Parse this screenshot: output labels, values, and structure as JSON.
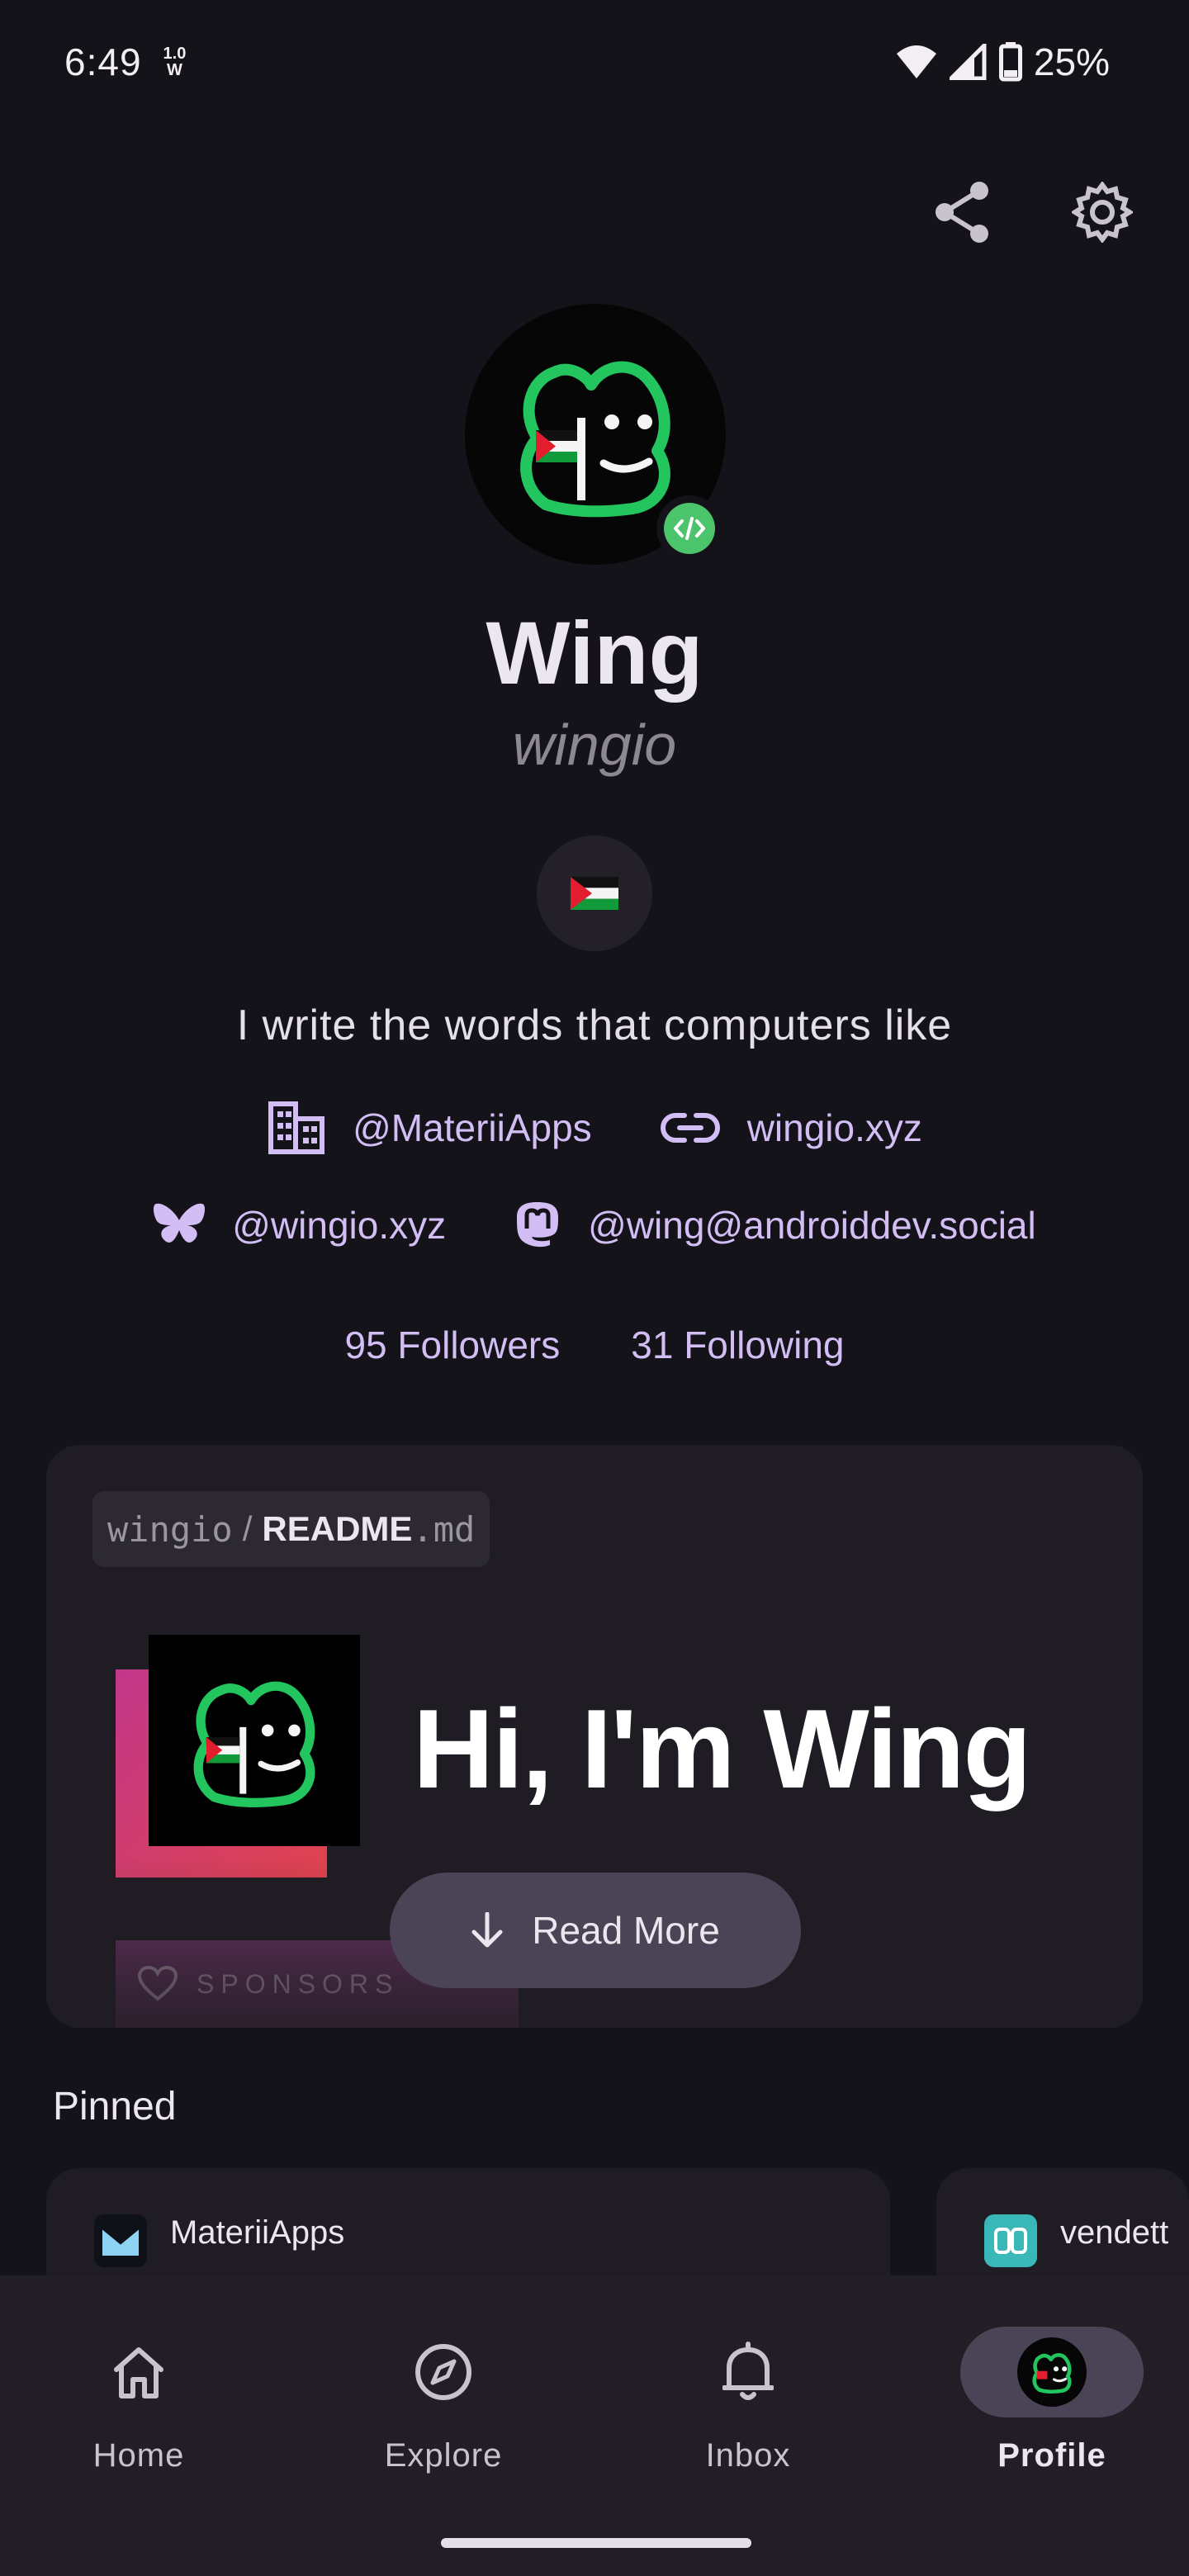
{
  "status_bar": {
    "time": "6:49",
    "net_speed_value": "1.0",
    "net_speed_unit": "W",
    "battery": "25%"
  },
  "profile": {
    "display_name": "Wing",
    "username": "wingio",
    "status_emoji": "🇵🇸",
    "bio": "I write the words that computers like",
    "company": "@MateriiApps",
    "website": "wingio.xyz",
    "bluesky": "@wingio.xyz",
    "mastodon": "@wing@androiddev.social",
    "followers": "95 Followers",
    "following": "31 Following"
  },
  "readme": {
    "owner": "wingio",
    "separator": "/",
    "file_name": "README",
    "file_ext": ".md",
    "heading": "Hi, I'm Wing",
    "sponsors_label": "SPONSORS",
    "read_more": "Read More"
  },
  "pinned": {
    "title": "Pinned",
    "items": [
      {
        "name": "MateriiApps"
      },
      {
        "name": "vendett"
      }
    ]
  },
  "nav": {
    "items": [
      {
        "label": "Home"
      },
      {
        "label": "Explore"
      },
      {
        "label": "Inbox"
      },
      {
        "label": "Profile"
      }
    ],
    "active": "Profile"
  },
  "colors": {
    "background": "#15131a",
    "card": "#1f1c24",
    "accent": "#d2bef5",
    "active_pill": "#4a4456",
    "frog_green": "#22c55e"
  }
}
